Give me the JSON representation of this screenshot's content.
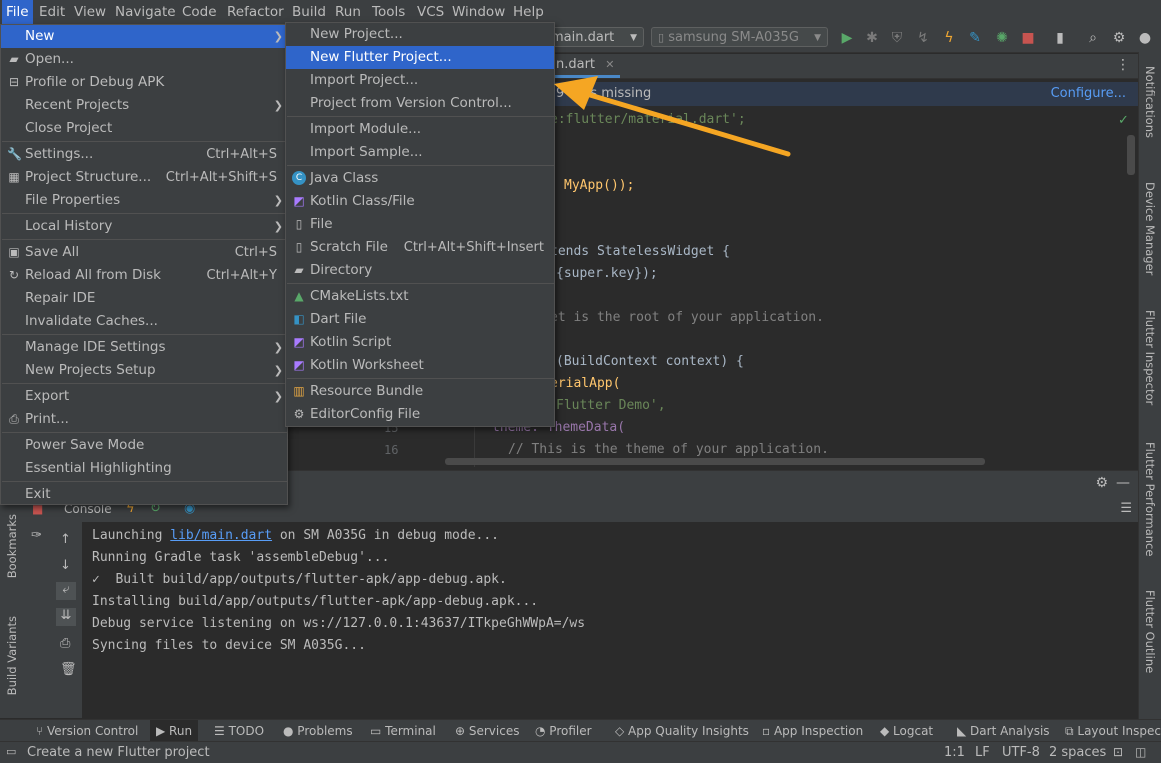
{
  "menubar": [
    "File",
    "Edit",
    "View",
    "Navigate",
    "Code",
    "Refactor",
    "Build",
    "Run",
    "Tools",
    "VCS",
    "Window",
    "Help"
  ],
  "toolbar": {
    "file_combo": "main.dart",
    "device_combo": "samsung SM-A035G"
  },
  "editor": {
    "tab": "n.dart",
    "banner_text": "9     n\" is missing",
    "banner_link": "Configure...",
    "lines": [
      {
        "text": "e:flutter/material.dart';"
      },
      {
        "text": "MyApp());"
      },
      {
        "text": "tends StatelessWidget {"
      },
      {
        "text": "{super.key});"
      },
      {
        "text": "et is the root of your application."
      },
      {
        "text": "(BuildContext context) {"
      },
      {
        "text": "erialApp("
      },
      {
        "text": "Flutter Demo',"
      },
      {
        "text": "theme: ThemeData("
      },
      {
        "text": "// This is the theme of your application."
      }
    ],
    "line_numbers": [
      "15",
      "16"
    ]
  },
  "file_menu": [
    {
      "label": "New",
      "arrow": true,
      "selected": true
    },
    {
      "label": "Open...",
      "icon": "folder-icon"
    },
    {
      "label": "Profile or Debug APK",
      "icon": "apk-icon"
    },
    {
      "label": "Recent Projects",
      "arrow": true
    },
    {
      "label": "Close Project"
    },
    {
      "label": "Settings...",
      "shortcut": "Ctrl+Alt+S",
      "icon": "wrench-icon"
    },
    {
      "label": "Project Structure...",
      "shortcut": "Ctrl+Alt+Shift+S",
      "icon": "project-structure-icon"
    },
    {
      "label": "File Properties",
      "arrow": true
    },
    {
      "label": "Local History",
      "arrow": true
    },
    {
      "label": "Save All",
      "shortcut": "Ctrl+S",
      "icon": "save-icon"
    },
    {
      "label": "Reload All from Disk",
      "shortcut": "Ctrl+Alt+Y",
      "icon": "reload-icon"
    },
    {
      "label": "Repair IDE"
    },
    {
      "label": "Invalidate Caches..."
    },
    {
      "label": "Manage IDE Settings",
      "arrow": true
    },
    {
      "label": "New Projects Setup",
      "arrow": true
    },
    {
      "label": "Export",
      "arrow": true
    },
    {
      "label": "Print...",
      "icon": "print-icon"
    },
    {
      "label": "Power Save Mode"
    },
    {
      "label": "Essential Highlighting"
    },
    {
      "label": "Exit"
    }
  ],
  "new_menu": [
    {
      "label": "New Project..."
    },
    {
      "label": "New Flutter Project...",
      "selected": true
    },
    {
      "label": "Import Project..."
    },
    {
      "label": "Project from Version Control..."
    },
    {
      "label": "Import Module..."
    },
    {
      "label": "Import Sample..."
    },
    {
      "label": "Java Class",
      "icon": "java-class-icon"
    },
    {
      "label": "Kotlin Class/File",
      "icon": "kotlin-icon"
    },
    {
      "label": "File",
      "icon": "file-icon"
    },
    {
      "label": "Scratch File",
      "shortcut": "Ctrl+Alt+Shift+Insert",
      "icon": "scratch-file-icon"
    },
    {
      "label": "Directory",
      "icon": "folder-icon"
    },
    {
      "label": "CMakeLists.txt",
      "icon": "cmake-icon"
    },
    {
      "label": "Dart File",
      "icon": "dart-icon"
    },
    {
      "label": "Kotlin Script",
      "icon": "kotlin-script-icon"
    },
    {
      "label": "Kotlin Worksheet",
      "icon": "kotlin-worksheet-icon"
    },
    {
      "label": "Resource Bundle",
      "icon": "resource-bundle-icon"
    },
    {
      "label": "EditorConfig File",
      "icon": "gear-icon"
    }
  ],
  "run_panel": {
    "tab": "Console",
    "console_link": "lib/main.dart",
    "console_lines": [
      "Launching ",
      " on SM A035G in debug mode...",
      "Running Gradle task 'assembleDebug'...",
      "✓  Built build/app/outputs/flutter-apk/app-debug.apk.",
      "Installing build/app/outputs/flutter-apk/app-debug.apk...",
      "Debug service listening on ws://127.0.0.1:43637/ITkpeGhWWpA=/ws",
      "Syncing files to device SM A035G..."
    ]
  },
  "left_strip": [
    "Bookmarks",
    "Build Variants"
  ],
  "right_strip": [
    "Notifications",
    "Device Manager",
    "Flutter Inspector",
    "Flutter Performance",
    "Flutter Outline"
  ],
  "bottom_tools": [
    "Version Control",
    "Run",
    "TODO",
    "Problems",
    "Terminal",
    "Services",
    "Profiler",
    "App Quality Insights",
    "App Inspection",
    "Logcat",
    "Dart Analysis",
    "Layout Inspector"
  ],
  "status": {
    "message": "Create a new Flutter project",
    "position": "1:1",
    "line_sep": "LF",
    "encoding": "UTF-8",
    "indent": "2 spaces"
  },
  "colors": {
    "accent": "#2f65ca",
    "arrow": "#f5a623",
    "panel": "#3c3f41",
    "editor": "#2b2b2b"
  }
}
